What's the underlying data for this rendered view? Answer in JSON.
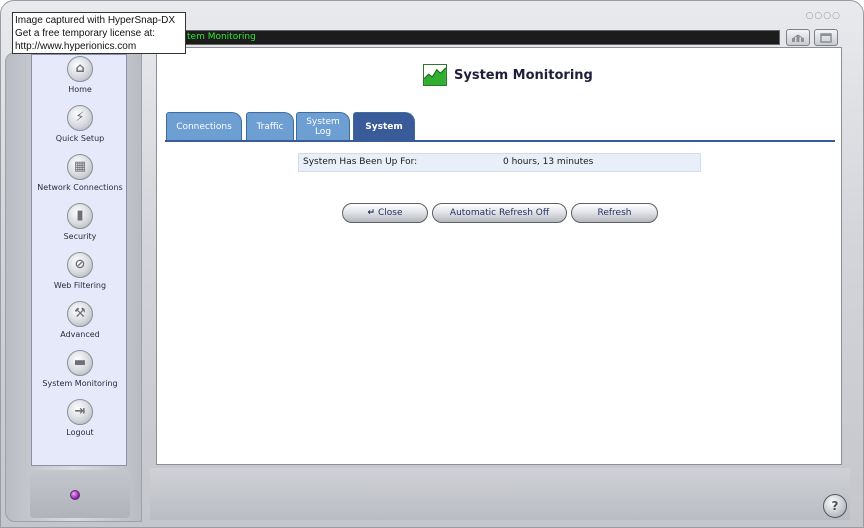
{
  "window": {
    "title": "System Monitoring",
    "title_bar_visible": "tem Monitoring",
    "decoration_dots": "○○○○"
  },
  "sidebar": {
    "items": [
      {
        "label": "Home",
        "icon": "home-icon",
        "glyph": "⌂"
      },
      {
        "label": "Quick Setup",
        "icon": "lightning-icon",
        "glyph": "⚡"
      },
      {
        "label": "Network Connections",
        "icon": "network-icon",
        "glyph": "▦"
      },
      {
        "label": "Security",
        "icon": "lock-icon",
        "glyph": "▮"
      },
      {
        "label": "Web Filtering",
        "icon": "filter-icon",
        "glyph": "⊘"
      },
      {
        "label": "Advanced",
        "icon": "tools-icon",
        "glyph": "⚒"
      },
      {
        "label": "System Monitoring",
        "icon": "chart-icon",
        "glyph": "▬"
      },
      {
        "label": "Logout",
        "icon": "logout-icon",
        "glyph": "⇥"
      }
    ]
  },
  "header": {
    "title": "System Monitoring",
    "icon": "system-monitoring-icon"
  },
  "tabs": [
    {
      "label": "Connections"
    },
    {
      "label": "Traffic"
    },
    {
      "label": "System Log"
    },
    {
      "label": "System",
      "active": true
    }
  ],
  "uptime": {
    "label": "System Has Been Up For:",
    "value": "0 hours, 13 minutes"
  },
  "buttons": {
    "close": "Close",
    "auto_refresh": "Automatic Refresh Off",
    "refresh": "Refresh"
  },
  "help": {
    "glyph": "?"
  },
  "watermark": {
    "line1": "Image captured with HyperSnap-DX",
    "line2": "Get a free temporary license at:",
    "line3": "http://www.hyperionics.com"
  },
  "colors": {
    "tab": "#6d9fd3",
    "tab_active": "#3a5b9a",
    "title_text": "#33e633",
    "sidebar_bg": "#e6e9fa"
  }
}
